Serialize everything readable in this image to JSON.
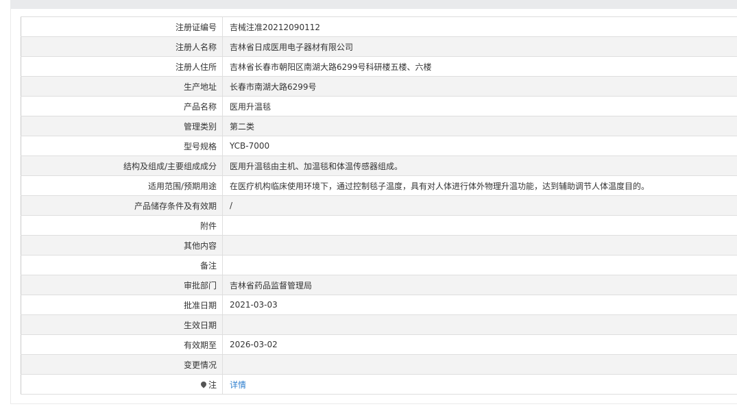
{
  "top_tabs": [
    "",
    "",
    ""
  ],
  "rows": [
    {
      "label": "注册证编号",
      "value": "吉械注准20212090112"
    },
    {
      "label": "注册人名称",
      "value": "吉林省日成医用电子器材有限公司"
    },
    {
      "label": "注册人住所",
      "value": "吉林省长春市朝阳区南湖大路6299号科研楼五楼、六楼"
    },
    {
      "label": "生产地址",
      "value": "长春市南湖大路6299号"
    },
    {
      "label": "产品名称",
      "value": "医用升温毯"
    },
    {
      "label": "管理类别",
      "value": "第二类"
    },
    {
      "label": "型号规格",
      "value": "YCB-7000"
    },
    {
      "label": "结构及组成/主要组成成分",
      "value": "医用升温毯由主机、加温毯和体温传感器组成。"
    },
    {
      "label": "适用范围/预期用途",
      "value": "在医疗机构临床使用环境下，通过控制毯子温度，具有对人体进行体外物理升温功能，达到辅助调节人体温度目的。"
    },
    {
      "label": "产品储存条件及有效期",
      "value": "/"
    },
    {
      "label": "附件",
      "value": ""
    },
    {
      "label": "其他内容",
      "value": ""
    },
    {
      "label": "备注",
      "value": ""
    },
    {
      "label": "审批部门",
      "value": "吉林省药品监督管理局"
    },
    {
      "label": "批准日期",
      "value": "2021-03-03"
    },
    {
      "label": "生效日期",
      "value": ""
    },
    {
      "label": "有效期至",
      "value": "2026-03-02"
    },
    {
      "label": "变更情况",
      "value": ""
    }
  ],
  "note": {
    "label": "注",
    "link_text": "详情",
    "icon": "pin-icon"
  }
}
